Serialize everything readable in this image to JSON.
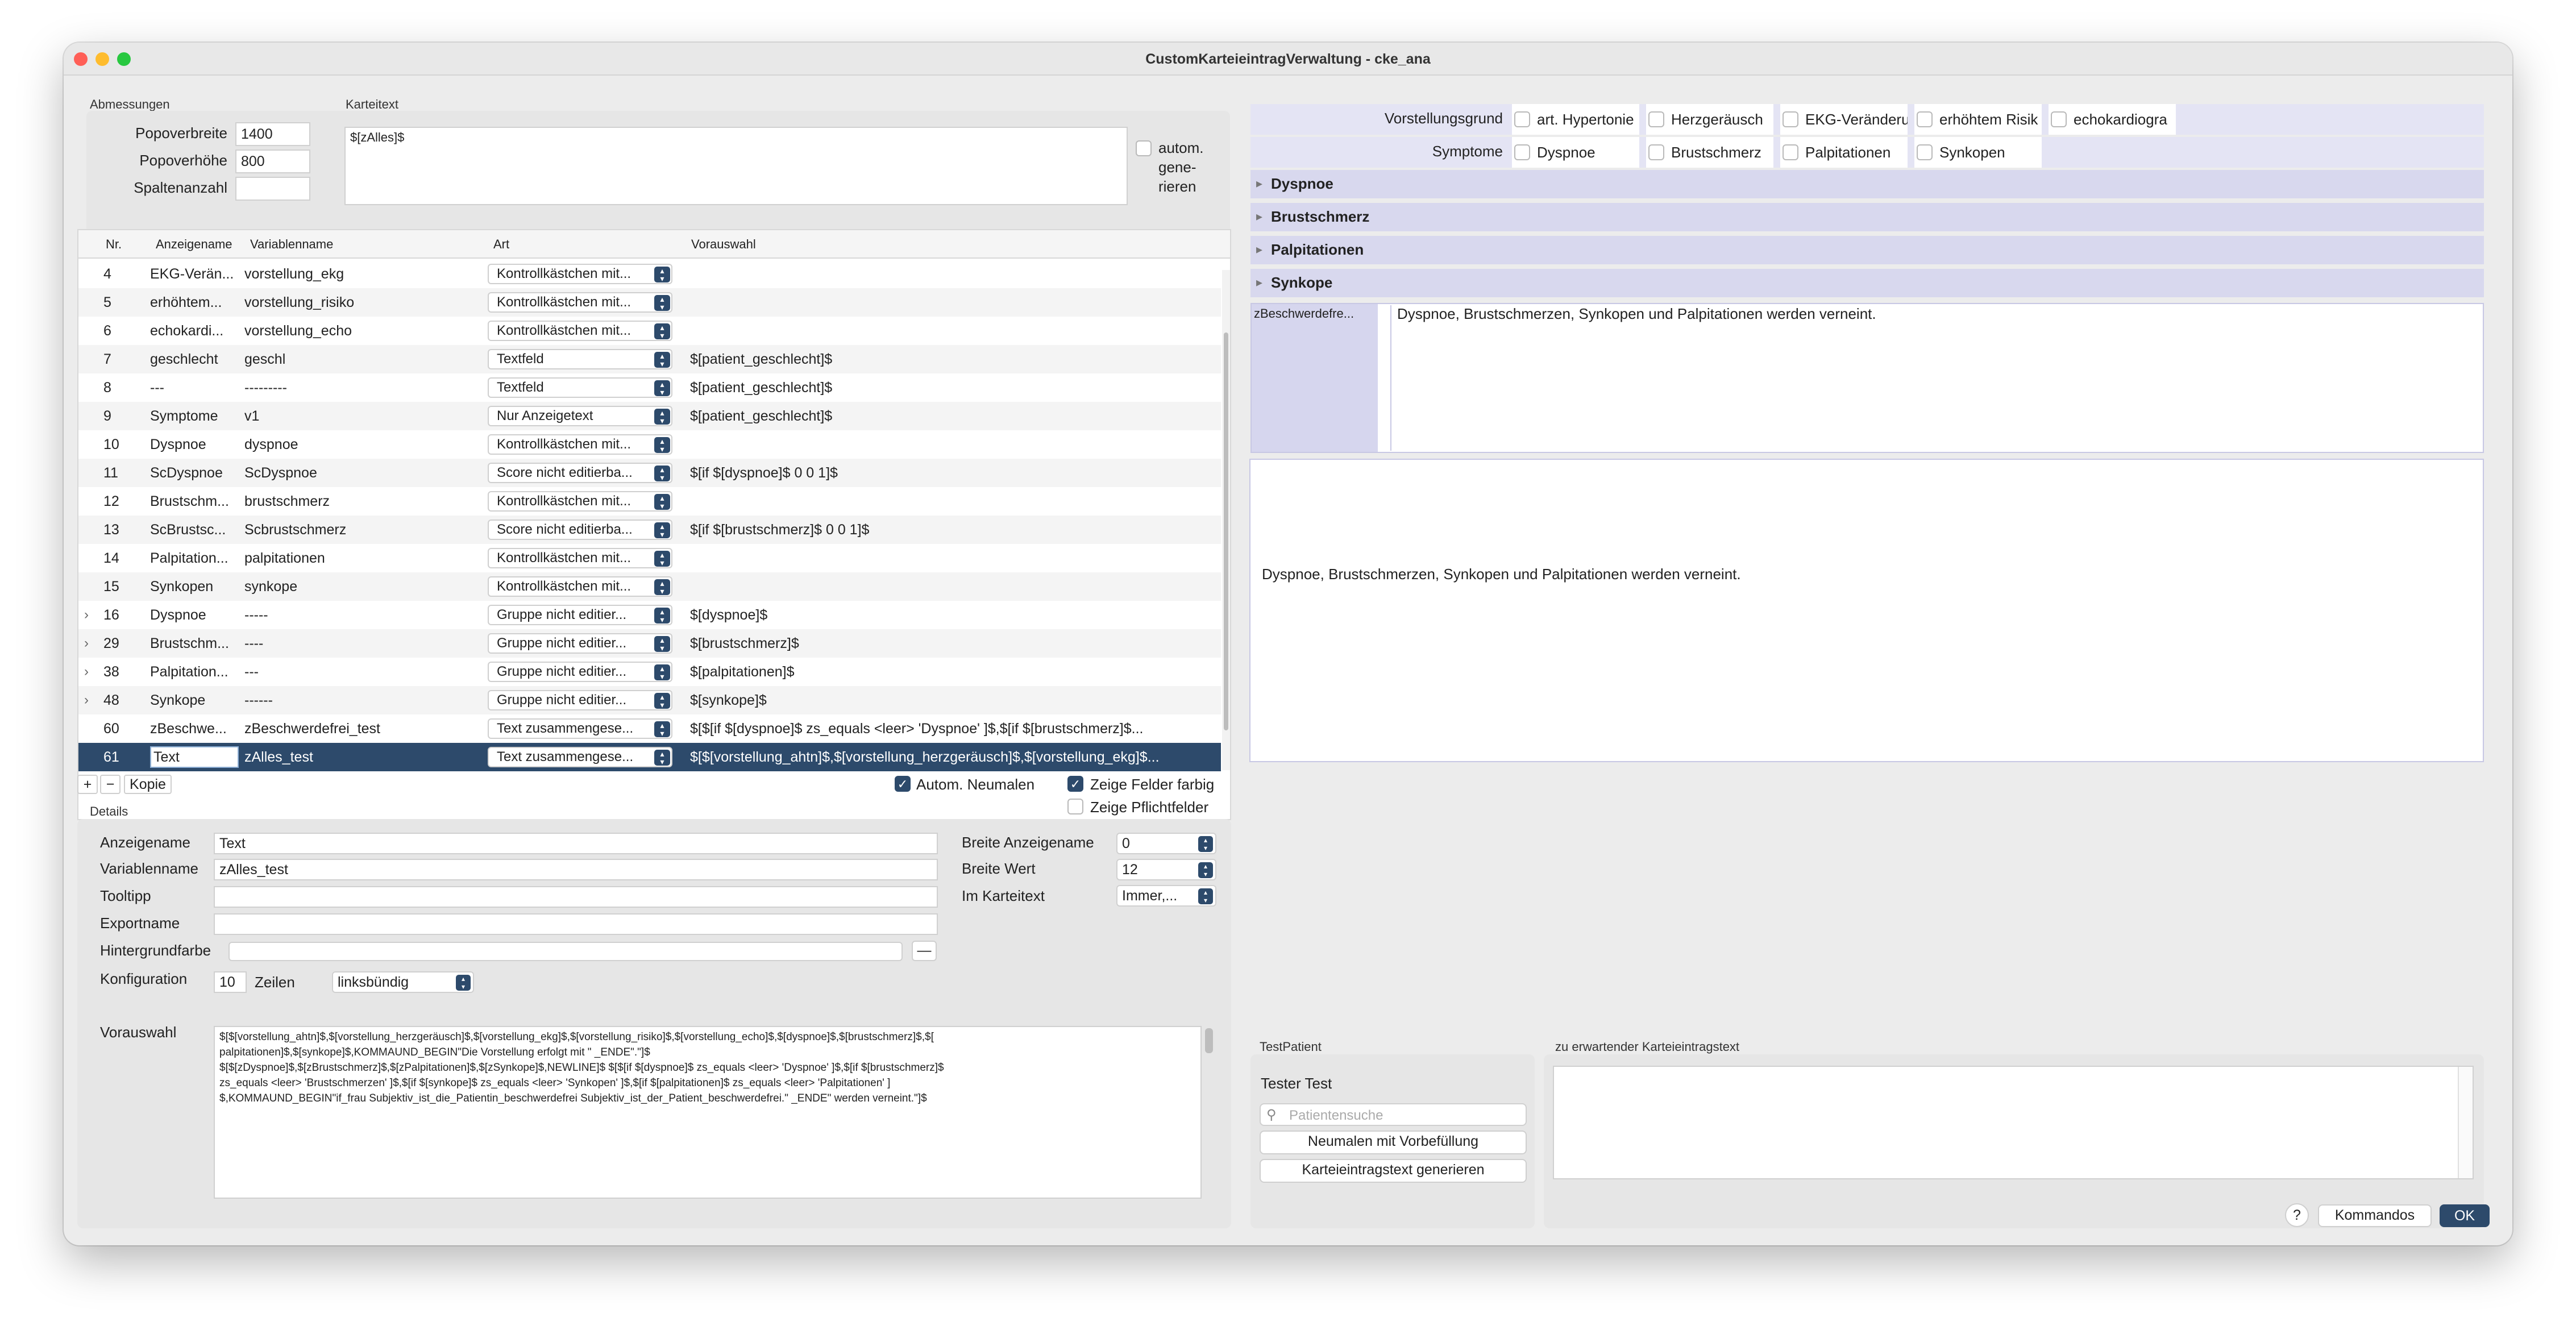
{
  "window": {
    "title": "CustomKarteieintragVerwaltung - cke_ana"
  },
  "abmessungen": {
    "group_label": "Abmessungen",
    "popoverbreite_label": "Popoverbreite",
    "popoverbreite_value": "1400",
    "popoverhoehe_label": "Popoverhöhe",
    "popoverhoehe_value": "800",
    "spaltenanzahl_label": "Spaltenanzahl",
    "spaltenanzahl_value": ""
  },
  "karteitext": {
    "group_label": "Karteitext",
    "value": "$[zAlles]$",
    "auto_label_1": "autom.",
    "auto_label_2": "gene-",
    "auto_label_3": "rieren"
  },
  "table": {
    "headers": {
      "nr": "Nr.",
      "anzeigename": "Anzeigename",
      "variablenname": "Variablenname",
      "art": "Art",
      "vorauswahl": "Vorauswahl"
    },
    "rows": [
      {
        "expand": "",
        "nr": "4",
        "anzeige": "EKG-Verän...",
        "var": "vorstellung_ekg",
        "art": "Kontrollkästchen mit...",
        "vor": ""
      },
      {
        "expand": "",
        "nr": "5",
        "anzeige": "erhöhtem...",
        "var": "vorstellung_risiko",
        "art": "Kontrollkästchen mit...",
        "vor": ""
      },
      {
        "expand": "",
        "nr": "6",
        "anzeige": "echokardi...",
        "var": "vorstellung_echo",
        "art": "Kontrollkästchen mit...",
        "vor": ""
      },
      {
        "expand": "",
        "nr": "7",
        "anzeige": "geschlecht",
        "var": "geschl",
        "art": "Textfeld",
        "vor": "$[patient_geschlecht]$"
      },
      {
        "expand": "",
        "nr": "8",
        "anzeige": "---",
        "var": "---------",
        "art": "Textfeld",
        "vor": "$[patient_geschlecht]$"
      },
      {
        "expand": "",
        "nr": "9",
        "anzeige": "Symptome",
        "var": "v1",
        "art": "Nur Anzeigetext",
        "vor": "$[patient_geschlecht]$"
      },
      {
        "expand": "",
        "nr": "10",
        "anzeige": "Dyspnoe",
        "var": "dyspnoe",
        "art": "Kontrollkästchen mit...",
        "vor": ""
      },
      {
        "expand": "",
        "nr": "11",
        "anzeige": "ScDyspnoe",
        "var": "ScDyspnoe",
        "art": "Score nicht editierba...",
        "vor": "$[if $[dyspnoe]$ 0 0 1]$"
      },
      {
        "expand": "",
        "nr": "12",
        "anzeige": "Brustschm...",
        "var": "brustschmerz",
        "art": "Kontrollkästchen mit...",
        "vor": ""
      },
      {
        "expand": "",
        "nr": "13",
        "anzeige": "ScBrustsc...",
        "var": "Scbrustschmerz",
        "art": "Score nicht editierba...",
        "vor": "$[if $[brustschmerz]$ 0 0 1]$"
      },
      {
        "expand": "",
        "nr": "14",
        "anzeige": "Palpitation...",
        "var": "palpitationen",
        "art": "Kontrollkästchen mit...",
        "vor": ""
      },
      {
        "expand": "",
        "nr": "15",
        "anzeige": "Synkopen",
        "var": "synkope",
        "art": "Kontrollkästchen mit...",
        "vor": ""
      },
      {
        "expand": "›",
        "nr": "16",
        "anzeige": "Dyspnoe",
        "var": "-----",
        "art": "Gruppe nicht editier...",
        "vor": "$[dyspnoe]$"
      },
      {
        "expand": "›",
        "nr": "29",
        "anzeige": "Brustschm...",
        "var": "----",
        "art": "Gruppe nicht editier...",
        "vor": "$[brustschmerz]$"
      },
      {
        "expand": "›",
        "nr": "38",
        "anzeige": "Palpitation...",
        "var": "---",
        "art": "Gruppe nicht editier...",
        "vor": "$[palpitationen]$"
      },
      {
        "expand": "›",
        "nr": "48",
        "anzeige": "Synkope",
        "var": "------",
        "art": "Gruppe nicht editier...",
        "vor": "$[synkope]$"
      },
      {
        "expand": "",
        "nr": "60",
        "anzeige": "zBeschwe...",
        "var": "zBeschwerdefrei_test",
        "art": "Text zusammengese...",
        "vor": "$[$[if $[dyspnoe]$ zs_equals <leer> 'Dyspnoe' ]$,$[if $[brustschmerz]$..."
      },
      {
        "expand": "",
        "nr": "61",
        "anzeige": "Text",
        "var": "zAlles_test",
        "art": "Text zusammengese...",
        "vor": "$[$[vorstellung_ahtn]$,$[vorstellung_herzgeräusch]$,$[vorstellung_ekg]$..."
      }
    ]
  },
  "tablebar": {
    "add": "+",
    "remove": "−",
    "copy": "Kopie",
    "autom_neumalen": "Autom. Neumalen",
    "zeige_farbig": "Zeige Felder farbig",
    "zeige_pflicht": "Zeige Pflichtfelder"
  },
  "details": {
    "group_label": "Details",
    "anzeigename_label": "Anzeigename",
    "anzeigename_value": "Text",
    "variablenname_label": "Variablenname",
    "variablenname_value": "zAlles_test",
    "tooltipp_label": "Tooltipp",
    "exportname_label": "Exportname",
    "hintergrund_label": "Hintergrundfarbe",
    "hintergrund_button": "—",
    "konfiguration_label": "Konfiguration",
    "zeilen_value": "10",
    "zeilen_label": "Zeilen",
    "align_value": "linksbündig",
    "breite_anzeige_label": "Breite Anzeigename",
    "breite_anzeige_value": "0",
    "breite_wert_label": "Breite Wert",
    "breite_wert_value": "12",
    "im_karteitext_label": "Im Karteitext",
    "im_karteitext_value": "Immer,...",
    "vorauswahl_label": "Vorauswahl",
    "vorauswahl_lines": [
      "$[$[vorstellung_ahtn]$,$[vorstellung_herzgeräusch]$,$[vorstellung_ekg]$,$[vorstellung_risiko]$,$[vorstellung_echo]$,$[dyspnoe]$,$[brustschmerz]$,$[",
      "palpitationen]$,$[synkope]$,KOMMAUND_BEGIN\"Die Vorstellung erfolgt mit \" _ENDE\".\"]$",
      "$[$[zDyspnoe]$,$[zBrustschmerz]$,$[zPalpitationen]$,$[zSynkope]$,NEWLINE]$ $[$[if $[dyspnoe]$ zs_equals <leer> 'Dyspnoe' ]$,$[if $[brustschmerz]$",
      "zs_equals <leer> 'Brustschmerzen' ]$,$[if $[synkope]$ zs_equals <leer> 'Synkopen' ]$,$[if $[palpitationen]$ zs_equals <leer> 'Palpitationen' ]",
      "$,KOMMAUND_BEGIN\"if_frau Subjektiv_ist_die_Patientin_beschwerdefrei Subjektiv_ist_der_Patient_beschwerdefrei.\" _ENDE\" werden verneint.\"]$"
    ]
  },
  "preview": {
    "vorstellungsgrund_label": "Vorstellungsgrund",
    "vorstellung_options": [
      "art. Hypertonie",
      "Herzgeräusch",
      "EKG-Veränderu",
      "erhöhtem Risik",
      "echokardiogra"
    ],
    "symptome_label": "Symptome",
    "symptome_options": [
      "Dyspnoe",
      "Brustschmerz",
      "Palpitationen",
      "Synkopen"
    ],
    "sections": [
      "Dyspnoe",
      "Brustschmerz",
      "Palpitationen",
      "Synkope"
    ],
    "zbeschwerde_label": "zBeschwerdefre...",
    "zbeschwerde_text": "Dyspnoe, Brustschmerzen, Synkopen und Palpitationen werden verneint.",
    "output_text": "Dyspnoe, Brustschmerzen, Synkopen und Palpitationen werden verneint."
  },
  "testpatient": {
    "group_label": "TestPatient",
    "name": "Tester Test",
    "search_placeholder": "Patientensuche",
    "btn_neumalen": "Neumalen mit Vorbefüllung",
    "btn_generieren": "Karteieintragstext generieren",
    "expected_label": "zu erwartender Karteieintragstext"
  },
  "footer": {
    "help": "?",
    "kommandos": "Kommandos",
    "ok": "OK"
  },
  "colors": {
    "selection": "#2d4a6b",
    "lavender": "#d6d6ee",
    "close": "#ff5f57",
    "minimize": "#febc2e",
    "zoom": "#28c840"
  }
}
